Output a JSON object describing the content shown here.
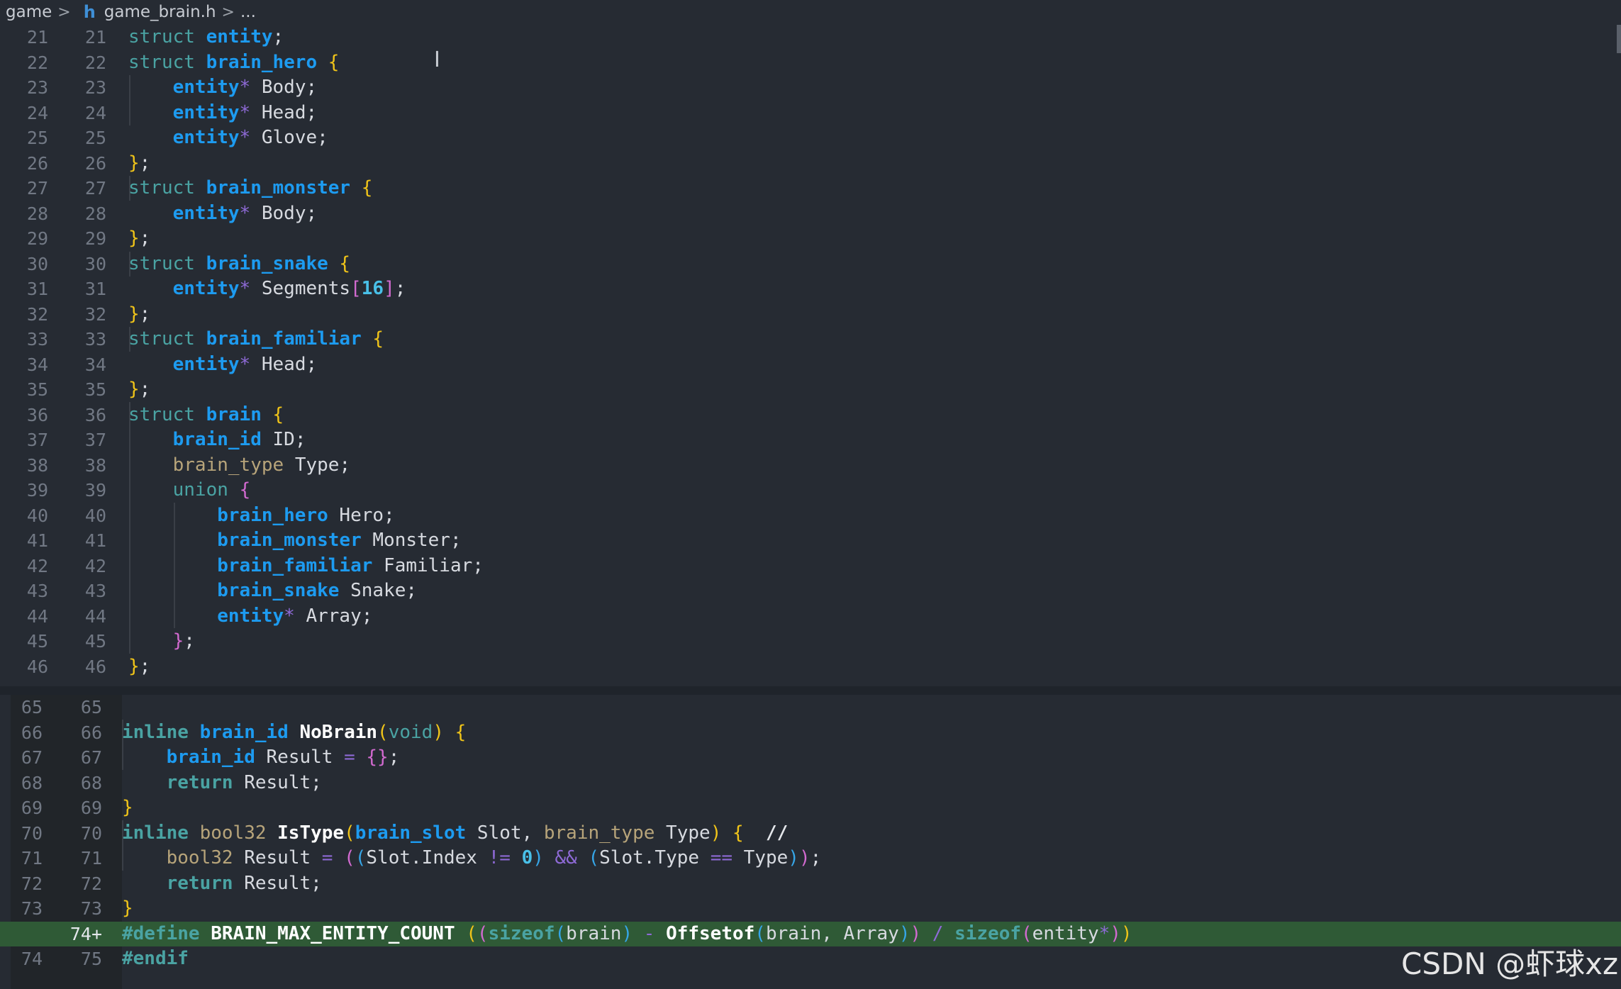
{
  "breadcrumb": {
    "folder": "game",
    "file": "game_brain.h",
    "more": "..."
  },
  "icons": {
    "file_icon": "h",
    "file_icon_color": "#3f8fd6"
  },
  "watermark": "CSDN @虾球xz",
  "colors": {
    "background": "#262b33",
    "added_line": "#2f5a36",
    "keyword": "#4aa3a3",
    "type": "#1d9bf0"
  },
  "top_pane": {
    "lines": [
      {
        "o": "21",
        "n": "21"
      },
      {
        "o": "22",
        "n": "22"
      },
      {
        "o": "23",
        "n": "23"
      },
      {
        "o": "24",
        "n": "24"
      },
      {
        "o": "25",
        "n": "25"
      },
      {
        "o": "26",
        "n": "26"
      },
      {
        "o": "27",
        "n": "27"
      },
      {
        "o": "28",
        "n": "28"
      },
      {
        "o": "29",
        "n": "29"
      },
      {
        "o": "30",
        "n": "30"
      },
      {
        "o": "31",
        "n": "31"
      },
      {
        "o": "32",
        "n": "32"
      },
      {
        "o": "33",
        "n": "33"
      },
      {
        "o": "34",
        "n": "34"
      },
      {
        "o": "35",
        "n": "35"
      },
      {
        "o": "36",
        "n": "36"
      },
      {
        "o": "37",
        "n": "37"
      },
      {
        "o": "38",
        "n": "38"
      },
      {
        "o": "39",
        "n": "39"
      },
      {
        "o": "40",
        "n": "40"
      },
      {
        "o": "41",
        "n": "41"
      },
      {
        "o": "42",
        "n": "42"
      },
      {
        "o": "43",
        "n": "43"
      },
      {
        "o": "44",
        "n": "44"
      },
      {
        "o": "45",
        "n": "45"
      },
      {
        "o": "46",
        "n": "46"
      }
    ]
  },
  "bottom_pane": {
    "lines": [
      {
        "o": "65",
        "n": "65"
      },
      {
        "o": "66",
        "n": "66"
      },
      {
        "o": "67",
        "n": "67"
      },
      {
        "o": "68",
        "n": "68"
      },
      {
        "o": "69",
        "n": "69"
      },
      {
        "o": "70",
        "n": "70"
      },
      {
        "o": "71",
        "n": "71"
      },
      {
        "o": "72",
        "n": "72"
      },
      {
        "o": "73",
        "n": "73"
      },
      {
        "o": "",
        "n": "74",
        "marker": "+"
      },
      {
        "o": "74",
        "n": "75"
      }
    ]
  },
  "code": {
    "t": {
      "struct": "struct",
      "union": "union",
      "inline": "inline",
      "return": "return",
      "void": "void",
      "entity": "entity",
      "brain_hero": "brain_hero",
      "brain_monster": "brain_monster",
      "brain_snake": "brain_snake",
      "brain_familiar": "brain_familiar",
      "brain": "brain",
      "brain_id": "brain_id",
      "brain_type": "brain_type",
      "brain_slot": "brain_slot",
      "bool32": "bool32",
      "star": "*",
      "Body": " Body;",
      "Head": " Head;",
      "Glove": " Glove;",
      "Segments": " Segments",
      "sixteen": "16",
      "ID": " ID;",
      "Type_decl": " Type;",
      "Hero": " Hero;",
      "Monster": " Monster;",
      "Familiar": " Familiar;",
      "Snake": " Snake;",
      "Array_decl": " Array;",
      "NoBrain": "NoBrain",
      "IsType": "IsType",
      "Result_init": " Result ",
      "Result_ret": " Result;",
      "Result_b": " Result ",
      "Slot_p": " Slot, ",
      "Type_p": " Type",
      "comment": "//",
      "Slot_Index": "Slot.Index ",
      "neq": "!=",
      "zero": "0",
      "and": "&&",
      "Slot_Type": "Slot.Type ",
      "eqeq": "==",
      "Type_r": " Type",
      "define": "#define",
      "macro": "BRAIN_MAX_ENTITY_COUNT",
      "sizeof": "sizeof",
      "brain_arg": "brain",
      "minus": "-",
      "Offsetof": "Offsetof",
      "brain_c": "brain, ",
      "Array_arg": "Array",
      "div": "/",
      "entity_arg": "entity",
      "endif": "#endif"
    }
  }
}
